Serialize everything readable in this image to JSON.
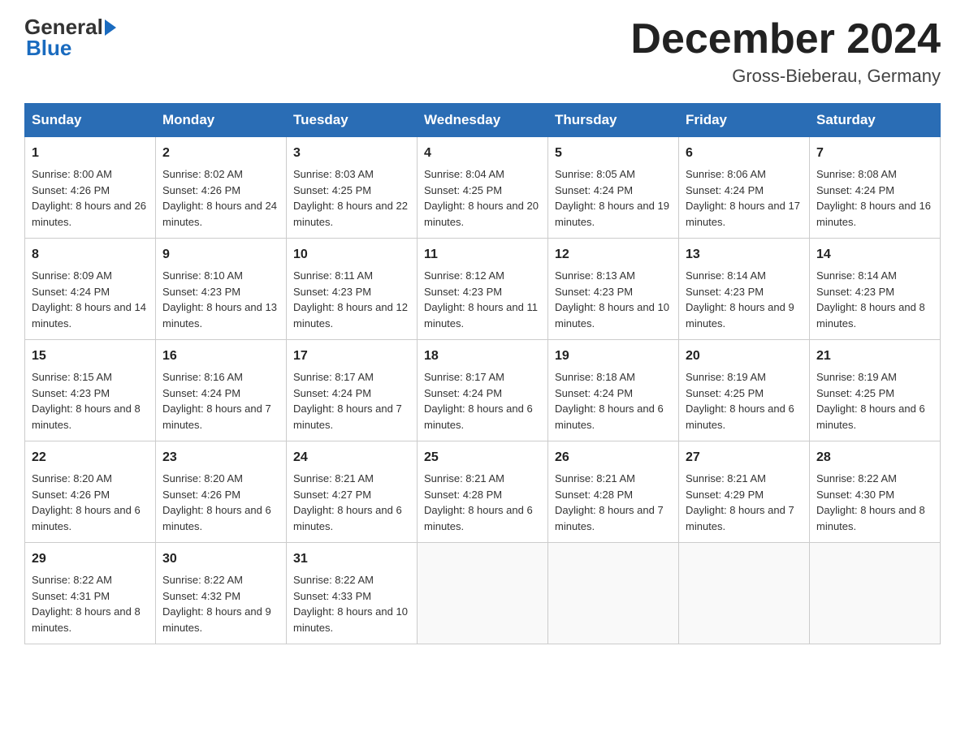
{
  "logo": {
    "text_general": "General",
    "text_blue": "Blue"
  },
  "header": {
    "title": "December 2024",
    "subtitle": "Gross-Bieberau, Germany"
  },
  "days_of_week": [
    "Sunday",
    "Monday",
    "Tuesday",
    "Wednesday",
    "Thursday",
    "Friday",
    "Saturday"
  ],
  "weeks": [
    [
      {
        "day": "1",
        "sunrise": "8:00 AM",
        "sunset": "4:26 PM",
        "daylight": "8 hours and 26 minutes."
      },
      {
        "day": "2",
        "sunrise": "8:02 AM",
        "sunset": "4:26 PM",
        "daylight": "8 hours and 24 minutes."
      },
      {
        "day": "3",
        "sunrise": "8:03 AM",
        "sunset": "4:25 PM",
        "daylight": "8 hours and 22 minutes."
      },
      {
        "day": "4",
        "sunrise": "8:04 AM",
        "sunset": "4:25 PM",
        "daylight": "8 hours and 20 minutes."
      },
      {
        "day": "5",
        "sunrise": "8:05 AM",
        "sunset": "4:24 PM",
        "daylight": "8 hours and 19 minutes."
      },
      {
        "day": "6",
        "sunrise": "8:06 AM",
        "sunset": "4:24 PM",
        "daylight": "8 hours and 17 minutes."
      },
      {
        "day": "7",
        "sunrise": "8:08 AM",
        "sunset": "4:24 PM",
        "daylight": "8 hours and 16 minutes."
      }
    ],
    [
      {
        "day": "8",
        "sunrise": "8:09 AM",
        "sunset": "4:24 PM",
        "daylight": "8 hours and 14 minutes."
      },
      {
        "day": "9",
        "sunrise": "8:10 AM",
        "sunset": "4:23 PM",
        "daylight": "8 hours and 13 minutes."
      },
      {
        "day": "10",
        "sunrise": "8:11 AM",
        "sunset": "4:23 PM",
        "daylight": "8 hours and 12 minutes."
      },
      {
        "day": "11",
        "sunrise": "8:12 AM",
        "sunset": "4:23 PM",
        "daylight": "8 hours and 11 minutes."
      },
      {
        "day": "12",
        "sunrise": "8:13 AM",
        "sunset": "4:23 PM",
        "daylight": "8 hours and 10 minutes."
      },
      {
        "day": "13",
        "sunrise": "8:14 AM",
        "sunset": "4:23 PM",
        "daylight": "8 hours and 9 minutes."
      },
      {
        "day": "14",
        "sunrise": "8:14 AM",
        "sunset": "4:23 PM",
        "daylight": "8 hours and 8 minutes."
      }
    ],
    [
      {
        "day": "15",
        "sunrise": "8:15 AM",
        "sunset": "4:23 PM",
        "daylight": "8 hours and 8 minutes."
      },
      {
        "day": "16",
        "sunrise": "8:16 AM",
        "sunset": "4:24 PM",
        "daylight": "8 hours and 7 minutes."
      },
      {
        "day": "17",
        "sunrise": "8:17 AM",
        "sunset": "4:24 PM",
        "daylight": "8 hours and 7 minutes."
      },
      {
        "day": "18",
        "sunrise": "8:17 AM",
        "sunset": "4:24 PM",
        "daylight": "8 hours and 6 minutes."
      },
      {
        "day": "19",
        "sunrise": "8:18 AM",
        "sunset": "4:24 PM",
        "daylight": "8 hours and 6 minutes."
      },
      {
        "day": "20",
        "sunrise": "8:19 AM",
        "sunset": "4:25 PM",
        "daylight": "8 hours and 6 minutes."
      },
      {
        "day": "21",
        "sunrise": "8:19 AM",
        "sunset": "4:25 PM",
        "daylight": "8 hours and 6 minutes."
      }
    ],
    [
      {
        "day": "22",
        "sunrise": "8:20 AM",
        "sunset": "4:26 PM",
        "daylight": "8 hours and 6 minutes."
      },
      {
        "day": "23",
        "sunrise": "8:20 AM",
        "sunset": "4:26 PM",
        "daylight": "8 hours and 6 minutes."
      },
      {
        "day": "24",
        "sunrise": "8:21 AM",
        "sunset": "4:27 PM",
        "daylight": "8 hours and 6 minutes."
      },
      {
        "day": "25",
        "sunrise": "8:21 AM",
        "sunset": "4:28 PM",
        "daylight": "8 hours and 6 minutes."
      },
      {
        "day": "26",
        "sunrise": "8:21 AM",
        "sunset": "4:28 PM",
        "daylight": "8 hours and 7 minutes."
      },
      {
        "day": "27",
        "sunrise": "8:21 AM",
        "sunset": "4:29 PM",
        "daylight": "8 hours and 7 minutes."
      },
      {
        "day": "28",
        "sunrise": "8:22 AM",
        "sunset": "4:30 PM",
        "daylight": "8 hours and 8 minutes."
      }
    ],
    [
      {
        "day": "29",
        "sunrise": "8:22 AM",
        "sunset": "4:31 PM",
        "daylight": "8 hours and 8 minutes."
      },
      {
        "day": "30",
        "sunrise": "8:22 AM",
        "sunset": "4:32 PM",
        "daylight": "8 hours and 9 minutes."
      },
      {
        "day": "31",
        "sunrise": "8:22 AM",
        "sunset": "4:33 PM",
        "daylight": "8 hours and 10 minutes."
      },
      null,
      null,
      null,
      null
    ]
  ]
}
